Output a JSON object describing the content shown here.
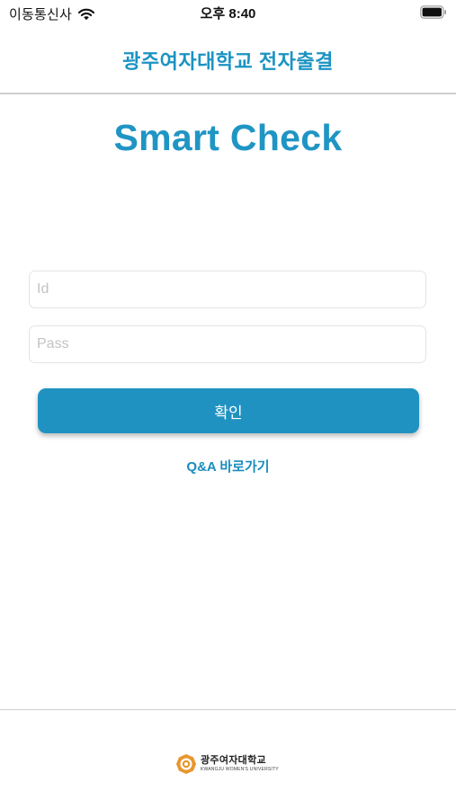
{
  "status_bar": {
    "carrier": "이동통신사",
    "time": "오후 8:40"
  },
  "header": {
    "title": "광주여자대학교 전자출결"
  },
  "main": {
    "app_title": "Smart Check",
    "id_placeholder": "Id",
    "pass_placeholder": "Pass",
    "confirm_label": "확인",
    "qa_link": "Q&A 바로가기"
  },
  "footer": {
    "logo_name": "광주여자대학교",
    "logo_sub": "KWANGJU WOMEN'S UNIVERSITY"
  },
  "colors": {
    "accent": "#1f95c4",
    "button": "#2092c2",
    "logo_orange": "#e8962e"
  },
  "icons": {
    "wifi": "wifi-icon",
    "battery": "battery-icon",
    "logo": "university-emblem-icon"
  }
}
